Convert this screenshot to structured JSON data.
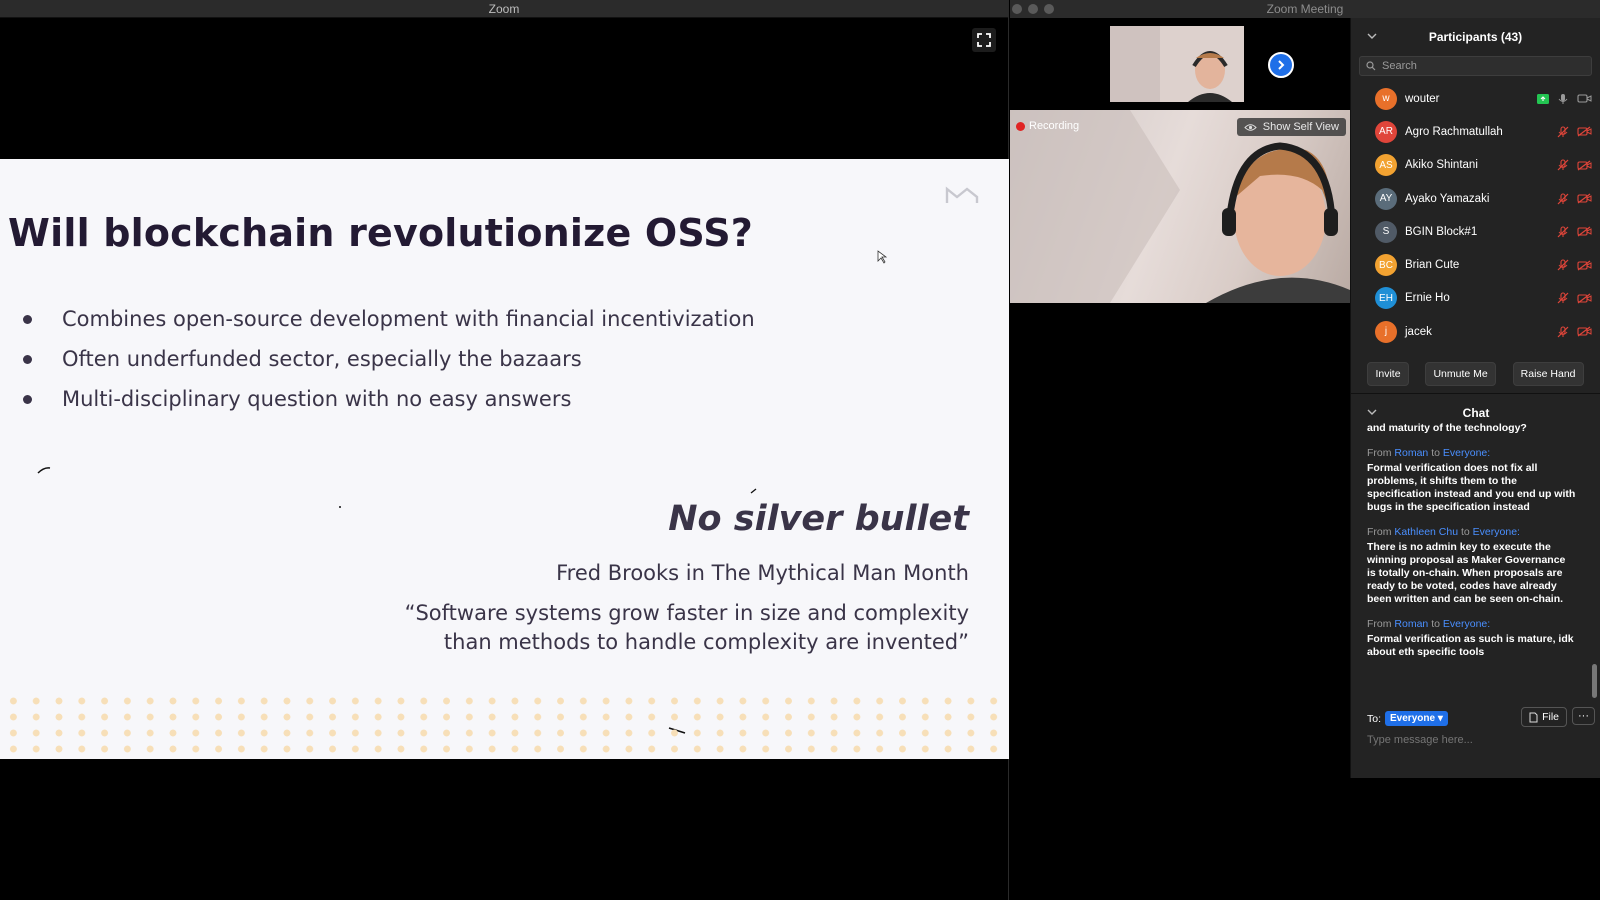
{
  "share_window": {
    "title": "Zoom"
  },
  "slide": {
    "title": "Will blockchain revolutionize OSS?",
    "bullets": [
      "Combines open-source development with financial incentivization",
      "Often underfunded sector, especially the bazaars",
      "Multi-disciplinary question with no easy answers"
    ],
    "quote_heading": "No silver bullet",
    "quote_author": "Fred Brooks in The Mythical Man Month",
    "quote_text": "“Software systems grow faster in size and complexity than methods to handle complexity are invented”",
    "logo_color": "#c8c8cf",
    "dot_color": "#f7dfb8"
  },
  "meeting_window": {
    "title": "Zoom Meeting",
    "recording_label": "Recording",
    "show_self_view_label": "Show Self View"
  },
  "participants_panel": {
    "title": "Participants (43)",
    "search_placeholder": "Search",
    "participants": [
      {
        "initials": "w",
        "name": "wouter",
        "color": "#e8702a",
        "host": true
      },
      {
        "initials": "AR",
        "name": "Agro Rachmatullah",
        "color": "#e0453a"
      },
      {
        "initials": "AS",
        "name": "Akiko Shintani",
        "color": "#f2a231"
      },
      {
        "initials": "AY",
        "name": "Ayako Yamazaki",
        "color": "#5a6c7a"
      },
      {
        "initials": "S",
        "name": "BGIN Block#1",
        "color": "#505a66"
      },
      {
        "initials": "BC",
        "name": "Brian Cute",
        "color": "#f2a231"
      },
      {
        "initials": "EH",
        "name": "Ernie Ho",
        "color": "#1f8fd6"
      },
      {
        "initials": "j",
        "name": "jacek",
        "color": "#e8702a"
      }
    ],
    "actions": {
      "invite": "Invite",
      "unmute": "Unmute Me",
      "raise_hand": "Raise Hand"
    }
  },
  "chat": {
    "title": "Chat",
    "first_line": "and maturity of the technology?",
    "from_word": "From",
    "to_word": "to",
    "messages": [
      {
        "from": "Roman",
        "to": "Everyone:",
        "text": "Formal verification does not fix all problems, it shifts them to the specification instead and you end up with bugs in the specification instead"
      },
      {
        "from": "Kathleen Chu",
        "to": "Everyone:",
        "text": "There is no admin key to execute the winning proposal as Maker Governance is totally on-chain. When proposals are ready to be voted, codes have already been written and can be seen on-chain."
      },
      {
        "from": "Roman",
        "to": "Everyone:",
        "text": "Formal verification as such is mature, idk about eth specific tools"
      }
    ],
    "to_label": "To:",
    "to_value": "Everyone",
    "file_label": "File",
    "more_label": "···",
    "input_placeholder": "Type message here...",
    "accent": "#1f6fe8"
  }
}
